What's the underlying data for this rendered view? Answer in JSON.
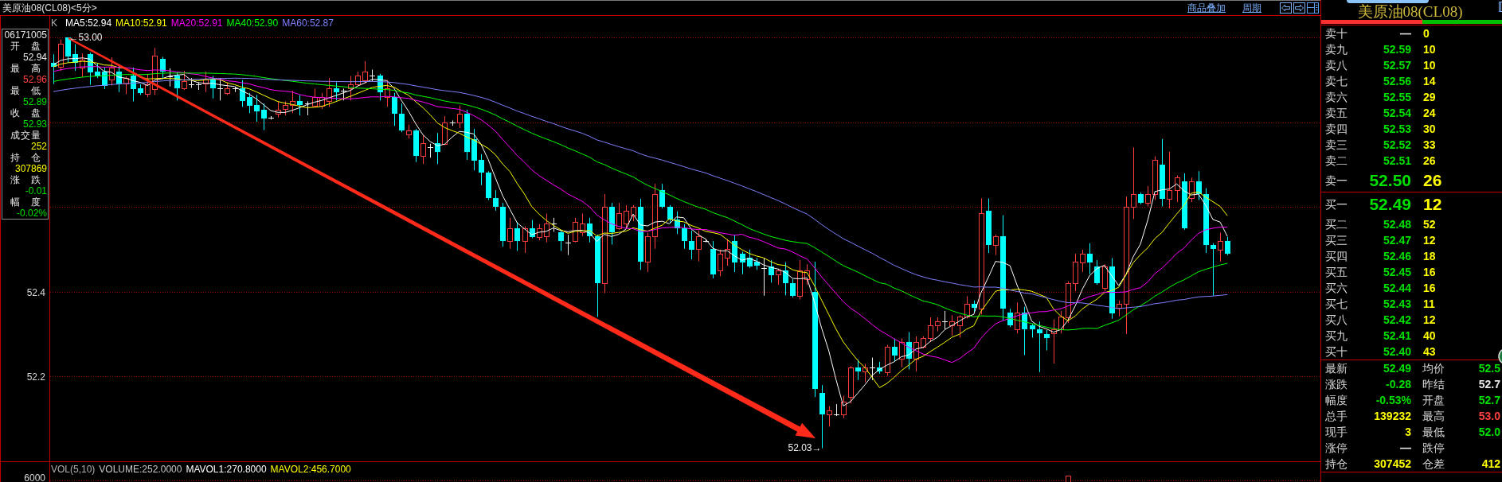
{
  "top_bar": {
    "title": "美原油08(CL08)<5分>",
    "links": [
      "商品叠加",
      "周期"
    ]
  },
  "chart": {
    "chart_type_label": "K",
    "indicators": [
      {
        "label": "MA5:52.94",
        "color": "#ffffff"
      },
      {
        "label": "MA10:52.91",
        "color": "#ffff00"
      },
      {
        "label": "MA20:52.91",
        "color": "#ff00ff"
      },
      {
        "label": "MA40:52.90",
        "color": "#00ff00"
      },
      {
        "label": "MA60:52.87",
        "color": "#8080ff"
      }
    ],
    "y_axis_labels": [
      "52.4",
      "52.2"
    ],
    "high_marker": "←53.00",
    "low_marker": "52.03→"
  },
  "info_panel": {
    "time": "06171005",
    "fields": [
      {
        "label": "开 盘",
        "value": "52.94",
        "color": "#e8e8e8"
      },
      {
        "label": "最 高",
        "value": "52.96",
        "color": "#ff4040"
      },
      {
        "label": "最 低",
        "value": "52.89",
        "color": "#00e000"
      },
      {
        "label": "收 盘",
        "value": "52.93",
        "color": "#00e000"
      },
      {
        "label": "成交量",
        "value": "252",
        "color": "#ffff00"
      },
      {
        "label": "持 仓",
        "value": "307869",
        "color": "#ffff00"
      },
      {
        "label": "涨 跌",
        "value": "-0.01",
        "color": "#00e000"
      },
      {
        "label": "幅 度",
        "value": "-0.02%",
        "color": "#00e000"
      }
    ]
  },
  "volume_panel": {
    "legend": [
      {
        "text": "VOL(5,10)",
        "color": "#b0b0b0"
      },
      {
        "text": "VOLUME:252.0000",
        "color": "#c8c8c8"
      },
      {
        "text": "MAVOL1:270.8000",
        "color": "#ffffff"
      },
      {
        "text": "MAVOL2:456.7000",
        "color": "#ffff00"
      }
    ],
    "axis_label": "6000"
  },
  "quote_panel": {
    "title": "美原油08(CL08)",
    "strength": {
      "level": 0.56
    },
    "asks": [
      {
        "label": "卖十",
        "price": "—",
        "volume": "0",
        "color": "#e0e0e0",
        "kind": "depth"
      },
      {
        "label": "卖九",
        "price": "52.59",
        "volume": "10",
        "color": "#00e000",
        "kind": "depth"
      },
      {
        "label": "卖八",
        "price": "52.57",
        "volume": "10",
        "color": "#00e000",
        "kind": "depth"
      },
      {
        "label": "卖七",
        "price": "52.56",
        "volume": "14",
        "color": "#00e000",
        "kind": "depth"
      },
      {
        "label": "卖六",
        "price": "52.55",
        "volume": "29",
        "color": "#00e000",
        "kind": "depth"
      },
      {
        "label": "卖五",
        "price": "52.54",
        "volume": "24",
        "color": "#00e000",
        "kind": "depth"
      },
      {
        "label": "卖四",
        "price": "52.53",
        "volume": "30",
        "color": "#00e000",
        "kind": "depth"
      },
      {
        "label": "卖三",
        "price": "52.52",
        "volume": "33",
        "color": "#00e000",
        "kind": "depth"
      },
      {
        "label": "卖二",
        "price": "52.51",
        "volume": "26",
        "color": "#00e000",
        "kind": "depth"
      },
      {
        "label": "卖一",
        "price": "52.50",
        "volume": "26",
        "color": "#00e000",
        "kind": "best"
      }
    ],
    "bids": [
      {
        "label": "买一",
        "price": "52.49",
        "volume": "12",
        "color": "#00e000",
        "kind": "best"
      },
      {
        "label": "买二",
        "price": "52.48",
        "volume": "52",
        "color": "#00e000",
        "kind": "depth"
      },
      {
        "label": "买三",
        "price": "52.47",
        "volume": "12",
        "color": "#00e000",
        "kind": "depth"
      },
      {
        "label": "买四",
        "price": "52.46",
        "volume": "18",
        "color": "#00e000",
        "kind": "depth"
      },
      {
        "label": "买五",
        "price": "52.45",
        "volume": "16",
        "color": "#00e000",
        "kind": "depth"
      },
      {
        "label": "买六",
        "price": "52.44",
        "volume": "16",
        "color": "#00e000",
        "kind": "depth"
      },
      {
        "label": "买七",
        "price": "52.43",
        "volume": "11",
        "color": "#00e000",
        "kind": "depth"
      },
      {
        "label": "买八",
        "price": "52.42",
        "volume": "12",
        "color": "#00e000",
        "kind": "depth"
      },
      {
        "label": "买九",
        "price": "52.41",
        "volume": "40",
        "color": "#00e000",
        "kind": "depth"
      },
      {
        "label": "买十",
        "price": "52.40",
        "volume": "43",
        "color": "#00e000",
        "kind": "depth"
      }
    ],
    "stats": [
      {
        "label": "最新",
        "value": "52.49",
        "color": "#00e000"
      },
      {
        "label": "均价",
        "value": "52.5",
        "color": "#00e000"
      },
      {
        "label": "涨跌",
        "value": "-0.28",
        "color": "#00e000"
      },
      {
        "label": "昨结",
        "value": "52.7",
        "color": "#e8e8e8"
      },
      {
        "label": "幅度",
        "value": "-0.53%",
        "color": "#00e000"
      },
      {
        "label": "开盘",
        "value": "52.7",
        "color": "#00e000"
      },
      {
        "label": "总手",
        "value": "139232",
        "color": "#ffff00"
      },
      {
        "label": "最高",
        "value": "53.0",
        "color": "#ff4040"
      },
      {
        "label": "现手",
        "value": "3",
        "color": "#ffff00"
      },
      {
        "label": "最低",
        "value": "52.0",
        "color": "#00e000"
      },
      {
        "label": "涨停",
        "value": "—",
        "color": "#e8e8e8"
      },
      {
        "label": "跌停"
      },
      {
        "label": "持仓",
        "value": "307452",
        "color": "#ffff00"
      },
      {
        "label": "仓差",
        "value": "412",
        "color": "#ffff00"
      }
    ]
  }
}
